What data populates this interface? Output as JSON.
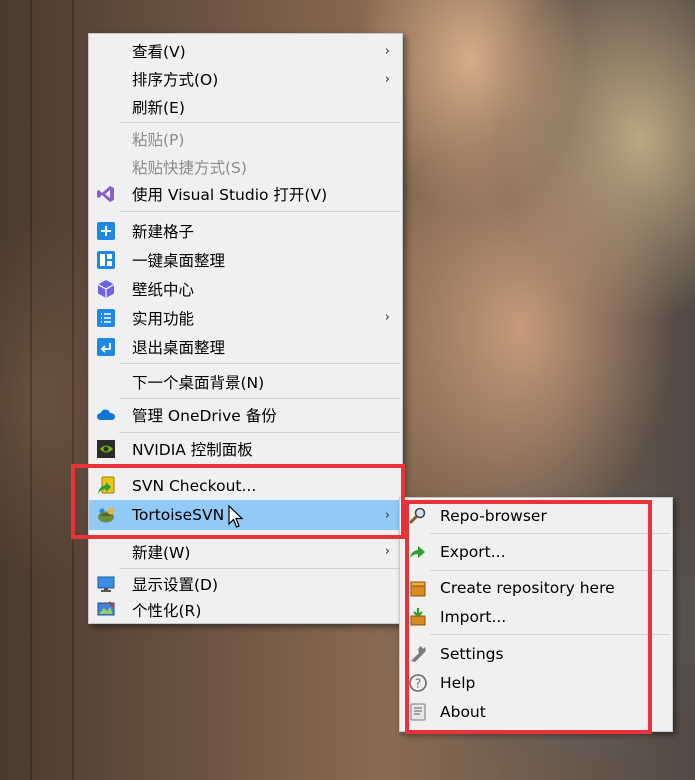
{
  "main_menu": {
    "view": "查看(V)",
    "sort": "排序方式(O)",
    "refresh": "刷新(E)",
    "paste": "粘贴(P)",
    "paste_shortcut": "粘贴快捷方式(S)",
    "open_vs": "使用 Visual Studio 打开(V)",
    "new_grid": "新建格子",
    "one_key_organize": "一键桌面整理",
    "wallpaper_center": "壁纸中心",
    "utilities": "实用功能",
    "exit_organize": "退出桌面整理",
    "next_background": "下一个桌面背景(N)",
    "onedrive_backup": "管理 OneDrive 备份",
    "nvidia_panel": "NVIDIA 控制面板",
    "svn_checkout": "SVN Checkout...",
    "tortoise_svn": "TortoiseSVN",
    "new": "新建(W)",
    "display_settings": "显示设置(D)",
    "personalize": "个性化(R)"
  },
  "submenu": {
    "repo_browser": "Repo-browser",
    "export": "Export...",
    "create_repository": "Create repository here",
    "import": "Import...",
    "settings": "Settings",
    "help": "Help",
    "about": "About"
  },
  "colors": {
    "menu_bg": "#f0f0f0",
    "hover_bg": "#91c9f7",
    "highlight_box": "#e8333b",
    "disabled_text": "#8c8c8c",
    "icon_blue": "#1e88e5",
    "vs_purple": "#865fc5"
  }
}
